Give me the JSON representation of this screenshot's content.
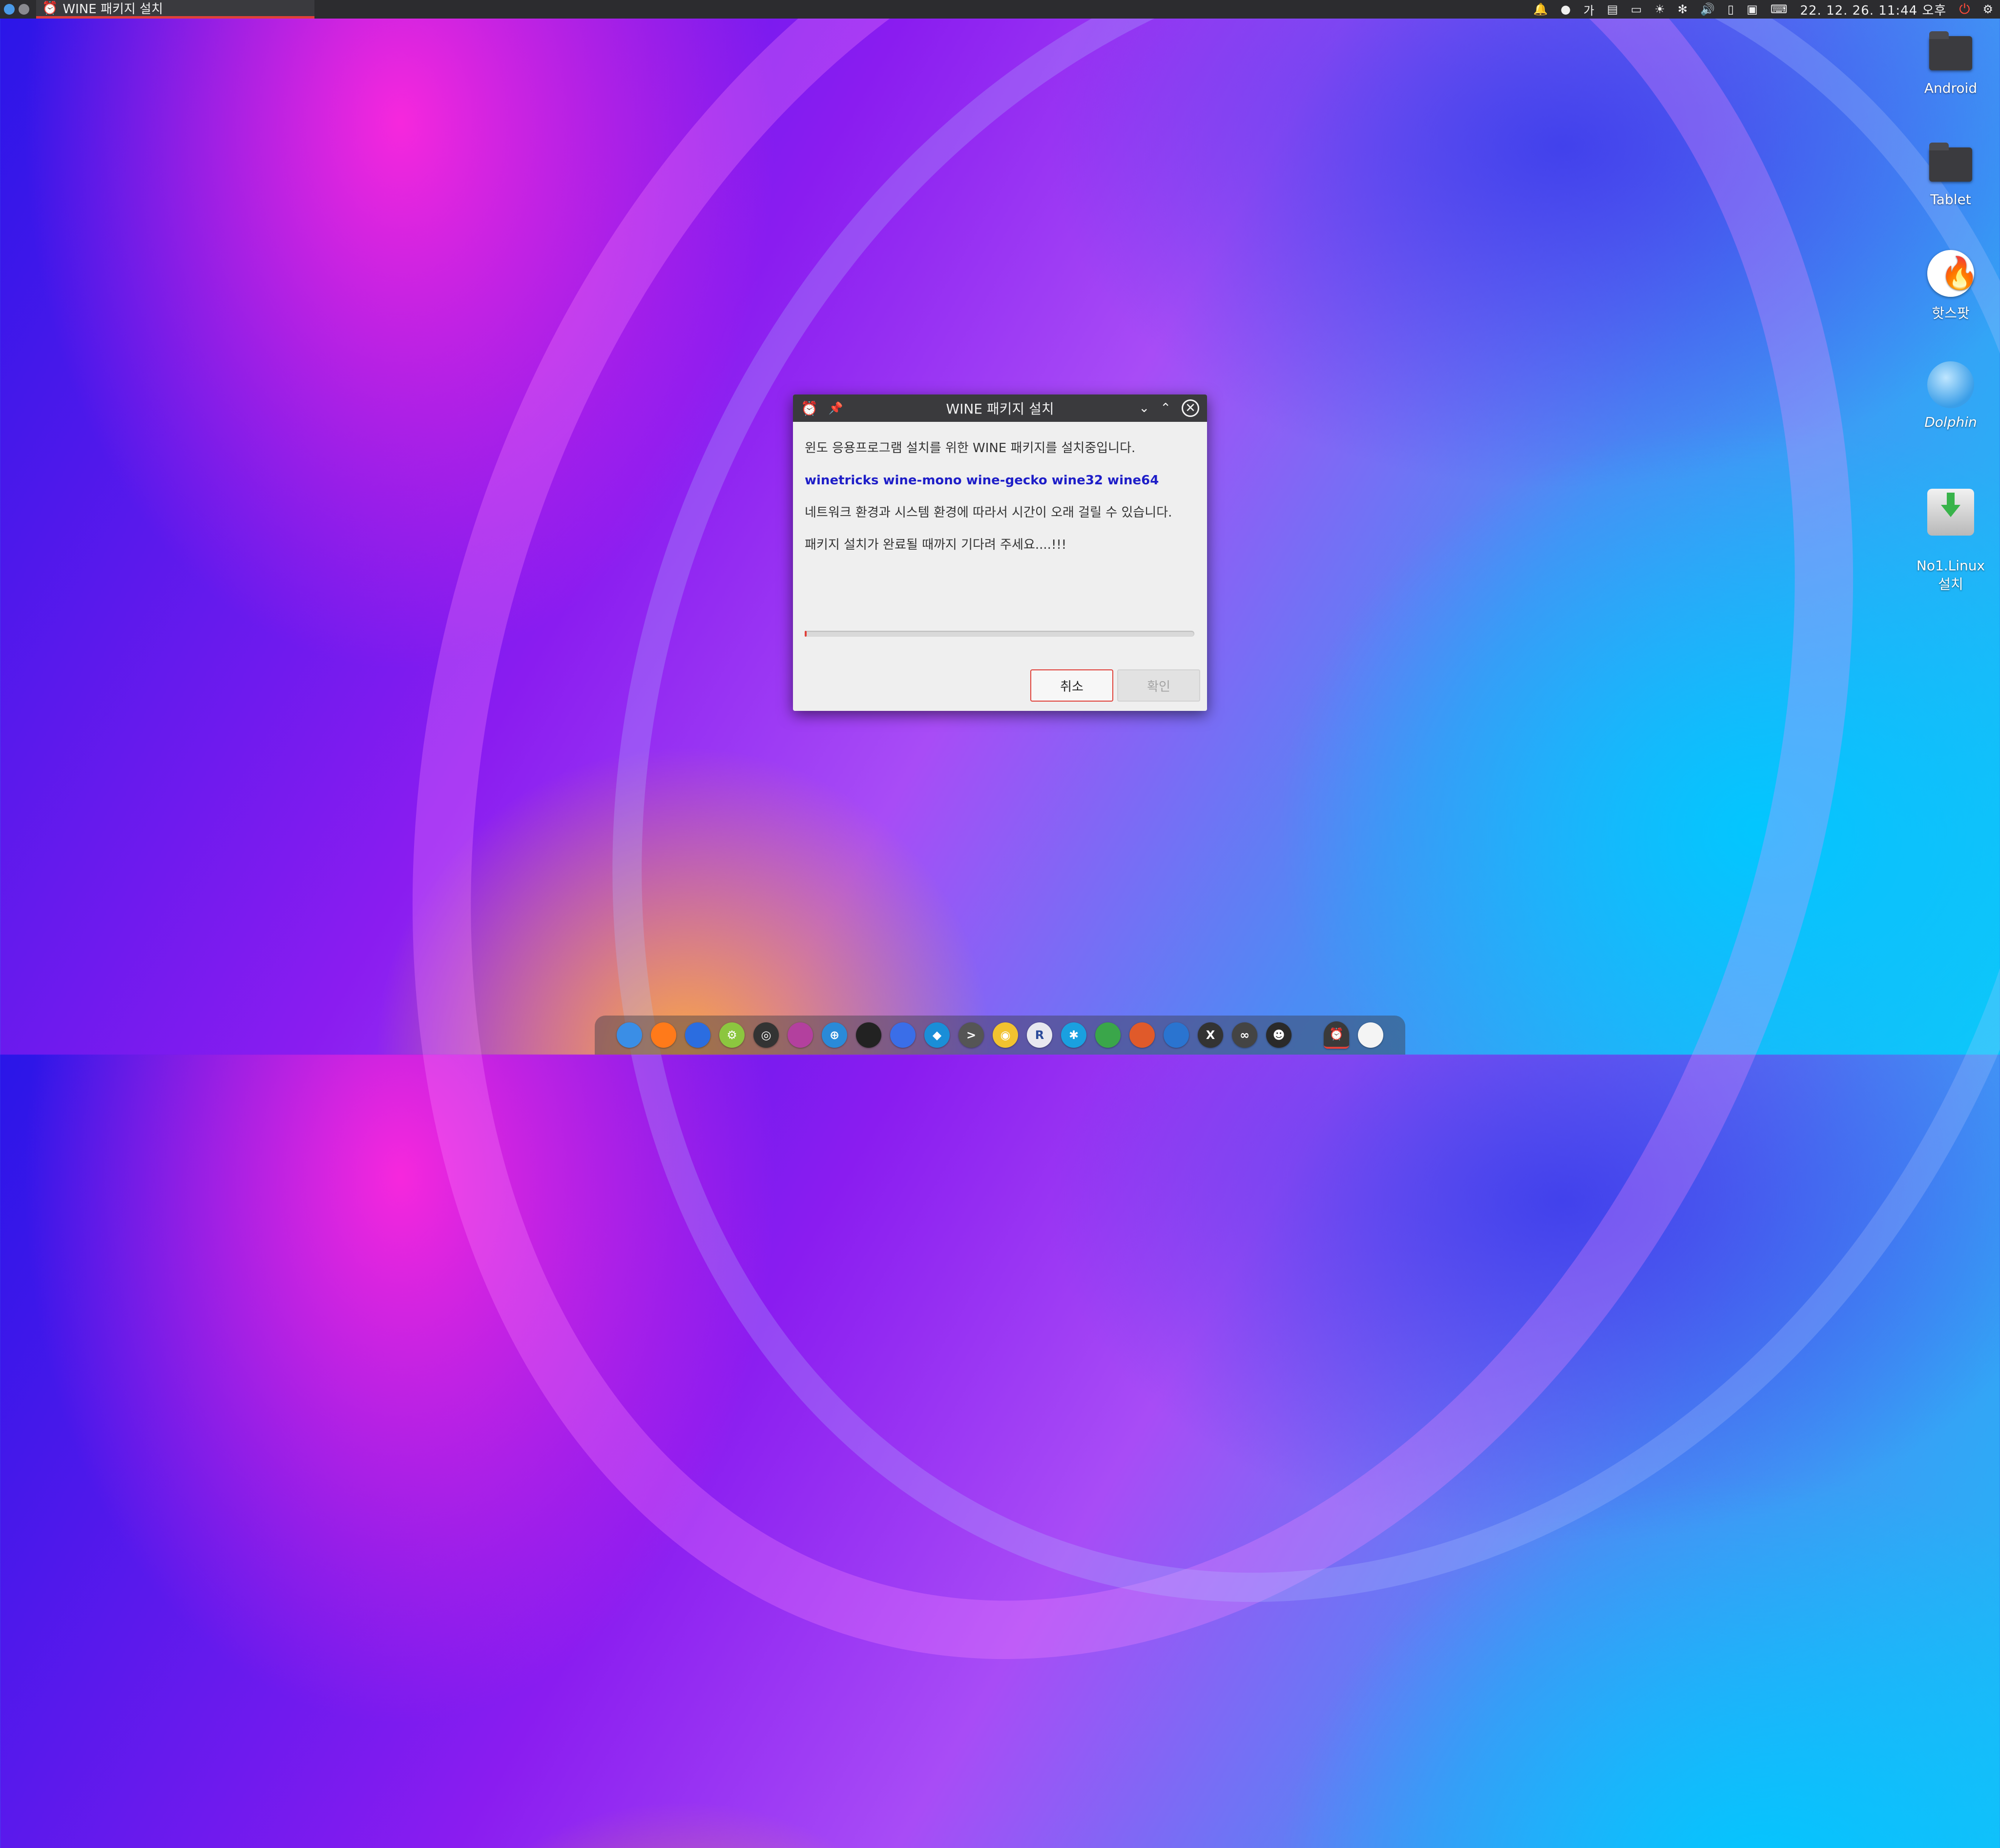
{
  "top_panel": {
    "active_task_title": "WINE 패키지 설치",
    "ime_label": "가",
    "clock": "22. 12. 26. 11:44 오후"
  },
  "desktop_icons": [
    {
      "label": "Android",
      "icon": "folder-icon"
    },
    {
      "label": "Tablet",
      "icon": "folder-icon"
    },
    {
      "label": "핫스팟",
      "icon": "hotspot-flame-icon"
    },
    {
      "label": "Dolphin",
      "icon": "dolphin-icon"
    },
    {
      "label": "No1.Linux\n설치",
      "icon": "installer-icon"
    }
  ],
  "dialog": {
    "title": "WINE 패키지 설치",
    "line1": "윈도 응용프로그램 설치를 위한 WINE 패키지를 설치중입니다.",
    "packages": "winetricks wine-mono wine-gecko wine32 wine64",
    "line3": "네트워크 환경과 시스템 환경에 따라서 시간이 오래 걸릴 수 있습니다.",
    "line4": "패키지 설치가 완료될 때까지 기다려 주세요....!!!",
    "progress_percent": 0.5,
    "cancel_label": "취소",
    "ok_label": "확인"
  },
  "dock": {
    "items": [
      {
        "name": "finder",
        "color": "#3a8ee6",
        "glyph": ""
      },
      {
        "name": "firefox",
        "color": "#ff7a1a",
        "glyph": ""
      },
      {
        "name": "toggle",
        "color": "#2b6de0",
        "glyph": ""
      },
      {
        "name": "settings",
        "color": "#8cc63f",
        "glyph": "⚙"
      },
      {
        "name": "camera",
        "color": "#333333",
        "glyph": "◎"
      },
      {
        "name": "browser",
        "color": "#b3409e",
        "glyph": ""
      },
      {
        "name": "network",
        "color": "#2a8ad8",
        "glyph": "⊕"
      },
      {
        "name": "inkscape",
        "color": "#222222",
        "glyph": ""
      },
      {
        "name": "mail",
        "color": "#3a6ee8",
        "glyph": ""
      },
      {
        "name": "kodi",
        "color": "#1a8ed8",
        "glyph": "◆"
      },
      {
        "name": "terminal",
        "color": "#555555",
        "glyph": ">"
      },
      {
        "name": "disc",
        "color": "#f2c230",
        "glyph": "◉"
      },
      {
        "name": "r-lang",
        "color": "#e8e8f0",
        "glyph": "R"
      },
      {
        "name": "kdeconnect",
        "color": "#1aa0e0",
        "glyph": "✱"
      },
      {
        "name": "spreadsheet",
        "color": "#3aa64a",
        "glyph": ""
      },
      {
        "name": "presentation",
        "color": "#e05a2a",
        "glyph": ""
      },
      {
        "name": "writer",
        "color": "#2a74d0",
        "glyph": ""
      },
      {
        "name": "x-app",
        "color": "#333333",
        "glyph": "X"
      },
      {
        "name": "share",
        "color": "#444444",
        "glyph": "∞"
      },
      {
        "name": "cat-app",
        "color": "#2a2a2a",
        "glyph": "☻"
      },
      {
        "name": "alarm-clock",
        "color": "#3a3a3a",
        "glyph": "⏰"
      },
      {
        "name": "circle-app",
        "color": "#f4f4f4",
        "glyph": ""
      }
    ]
  }
}
